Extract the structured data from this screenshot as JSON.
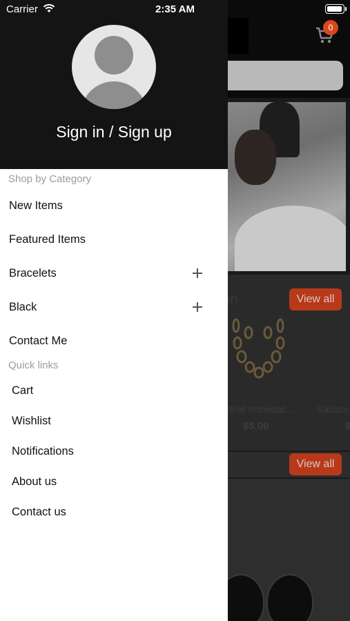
{
  "status_bar": {
    "carrier": "Carrier",
    "time": "2:35 AM"
  },
  "background": {
    "cart_count": "0",
    "section_title": "ion",
    "view_all_label": "View all",
    "products": [
      {
        "name": "ustrial Intimidat…",
        "price": "$5.00"
      },
      {
        "name": "Sahara",
        "price": "$"
      }
    ]
  },
  "drawer": {
    "signin_label": "Sign in / Sign up",
    "shop_by_category_label": "Shop by Category",
    "categories": [
      {
        "label": "New Items",
        "expandable": false
      },
      {
        "label": "Featured Items",
        "expandable": false
      },
      {
        "label": "Bracelets",
        "expandable": true
      },
      {
        "label": "Black",
        "expandable": true
      },
      {
        "label": "Contact Me",
        "expandable": false
      }
    ],
    "quick_links_label": "Quick links",
    "quick_links": [
      {
        "label": "Cart"
      },
      {
        "label": "Wishlist"
      },
      {
        "label": "Notifications"
      },
      {
        "label": "About us"
      },
      {
        "label": "Contact us"
      }
    ]
  },
  "colors": {
    "drawer_header": "#141414",
    "accent": "#d9481c",
    "overlay": "#000000"
  }
}
